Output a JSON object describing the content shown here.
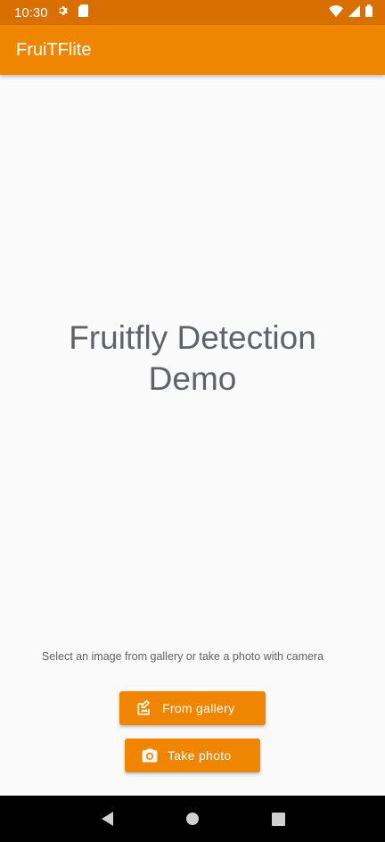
{
  "status_bar": {
    "time": "10:30",
    "icons": [
      "gear-icon",
      "sd-card-icon",
      "wifi-icon",
      "signal-icon",
      "battery-icon"
    ]
  },
  "app_bar": {
    "title": "FruiTFlite"
  },
  "main": {
    "headline_line1": "Fruitfly Detection",
    "headline_line2": "Demo",
    "hint": "Select an image from gallery or take a photo with camera"
  },
  "buttons": {
    "gallery_label": "From gallery",
    "gallery_icon": "gallery-icon",
    "camera_label": "Take photo",
    "camera_icon": "camera-icon"
  },
  "nav_bar": {
    "items": [
      "back-icon",
      "home-icon",
      "recents-icon"
    ]
  },
  "colors": {
    "status_bar": "#d86f00",
    "primary": "#ef8500",
    "headline": "#5f6368",
    "background": "#fafafa",
    "nav_bar": "#000000"
  }
}
